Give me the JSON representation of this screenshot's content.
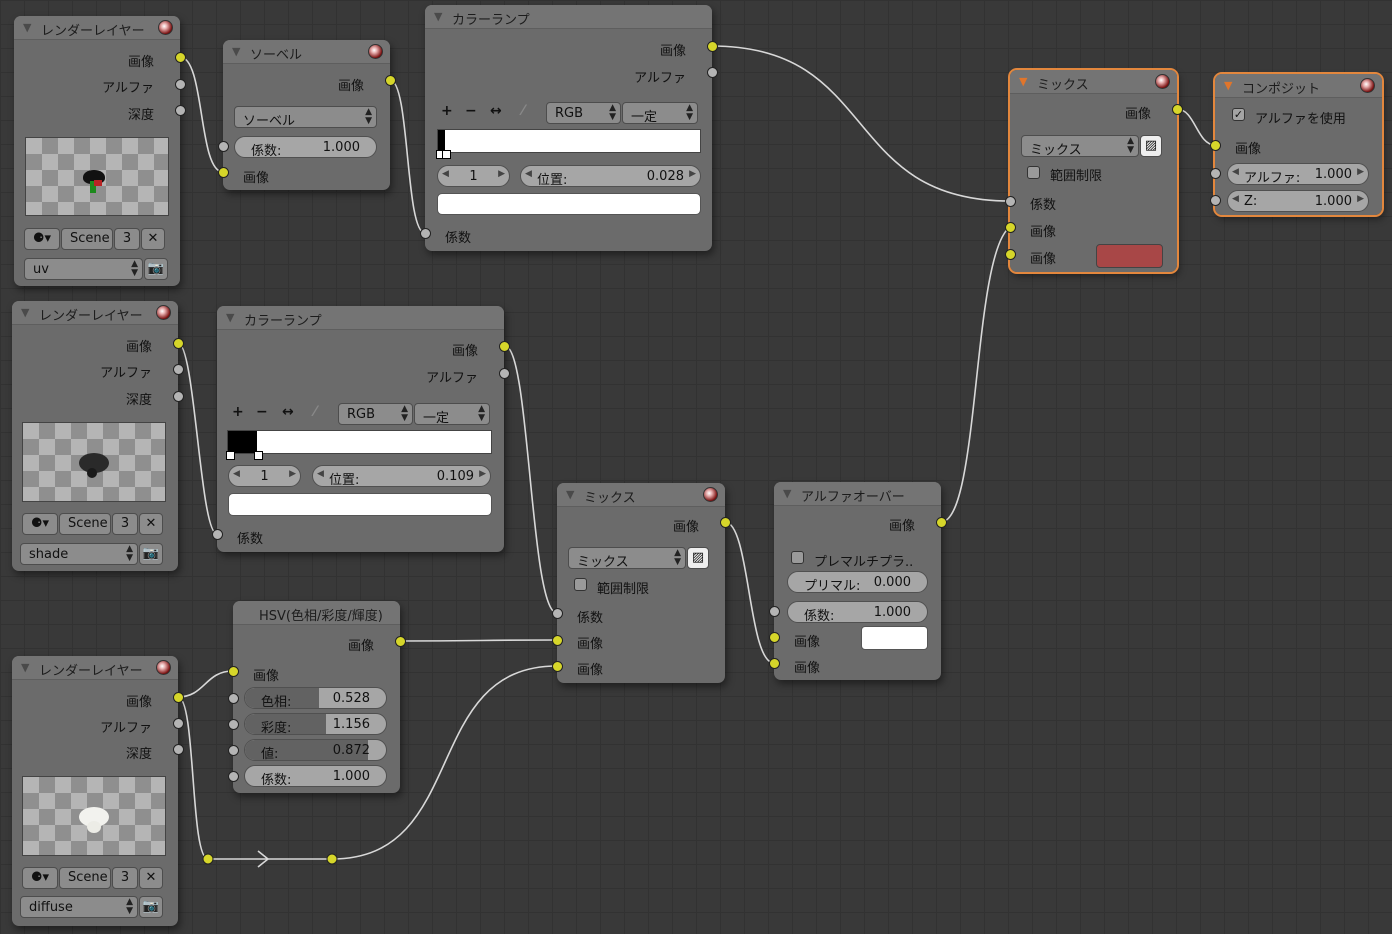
{
  "socket_labels": {
    "image": "画像",
    "alpha": "アルファ",
    "depth": "深度",
    "factor": "係数"
  },
  "render_layers": [
    {
      "title": "レンダーレイヤー",
      "scene_label": "Scene",
      "scene_users": "3",
      "layer": "uv"
    },
    {
      "title": "レンダーレイヤー",
      "scene_label": "Scene",
      "scene_users": "3",
      "layer": "shade"
    },
    {
      "title": "レンダーレイヤー",
      "scene_label": "Scene",
      "scene_users": "3",
      "layer": "diffuse"
    }
  ],
  "sobel": {
    "title": "ソーベル",
    "type": "ソーベル",
    "fac_label": "係数:",
    "fac_value": "1.000"
  },
  "color_ramps": [
    {
      "title": "カラーランプ",
      "color_mode": "RGB",
      "interpolation": "一定",
      "index": "1",
      "pos_label": "位置:",
      "pos_value": "0.028",
      "stop_fraction": 0.028
    },
    {
      "title": "カラーランプ",
      "color_mode": "RGB",
      "interpolation": "一定",
      "index": "1",
      "pos_label": "位置:",
      "pos_value": "0.109",
      "stop_fraction": 0.109
    }
  ],
  "mix_top": {
    "title": "ミックス",
    "blend": "ミックス",
    "clamp_label": "範囲制限",
    "swatch_color": "#a84747"
  },
  "composite": {
    "title": "コンポジット",
    "use_alpha_label": "アルファを使用",
    "use_alpha": true,
    "alpha_label": "アルファ:",
    "alpha_value": "1.000",
    "z_label": "Z:",
    "z_value": "1.000"
  },
  "hsv": {
    "title": "HSV(色相/彩度/輝度)",
    "hue_label": "色相:",
    "hue_value": "0.528",
    "sat_label": "彩度:",
    "sat_value": "1.156",
    "val_label": "値:",
    "val_value": "0.872",
    "fac_label": "係数:",
    "fac_value": "1.000"
  },
  "mix_mid": {
    "title": "ミックス",
    "blend": "ミックス",
    "clamp_label": "範囲制限"
  },
  "alpha_over": {
    "title": "アルファオーバー",
    "premul_conv_label": "プレマルチプラ..",
    "premul_label": "プリマル:",
    "premul_value": "0.000",
    "fac_label": "係数:",
    "fac_value": "1.000"
  },
  "colors": {
    "socket_color": "#d6d62a",
    "socket_value": "#b4b4b4",
    "active_outline": "#e3873d",
    "node_body": "#6b6b6b"
  }
}
